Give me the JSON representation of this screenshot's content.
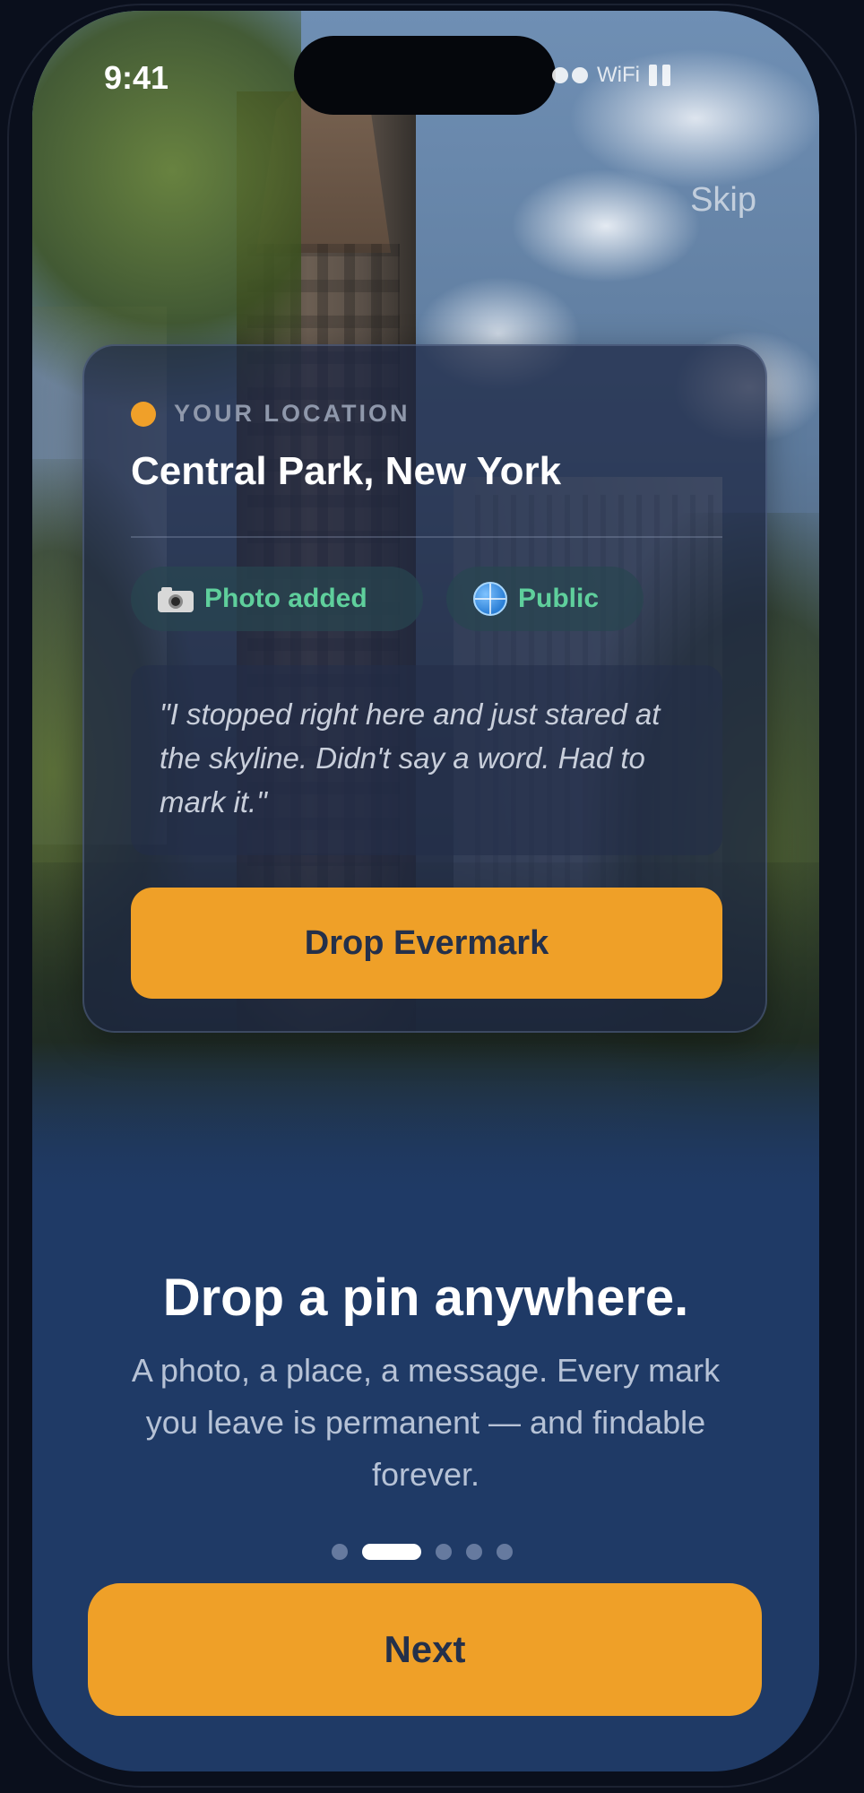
{
  "status_bar": {
    "time": "9:41",
    "wifi_label": "WiFi"
  },
  "header": {
    "skip_label": "Skip"
  },
  "card": {
    "location_label": "YOUR LOCATION",
    "place_name": "Central Park, New York",
    "chips": [
      {
        "icon": "camera-icon",
        "label": "Photo added"
      },
      {
        "icon": "globe-icon",
        "label": "Public"
      }
    ],
    "quote": "\"I stopped right here and just stared at the skyline. Didn't say a word. Had to mark it.\"",
    "drop_button_label": "Drop Evermark"
  },
  "onboarding": {
    "headline": "Drop a pin anywhere.",
    "subtext": "A photo, a place, a message. Every mark you leave is permanent — and findable forever.",
    "page_count": 5,
    "active_page": 2,
    "next_button_label": "Next"
  },
  "colors": {
    "accent": "#efa028",
    "background_navy": "#1f3a66",
    "chip_text": "#5fcf9c"
  }
}
